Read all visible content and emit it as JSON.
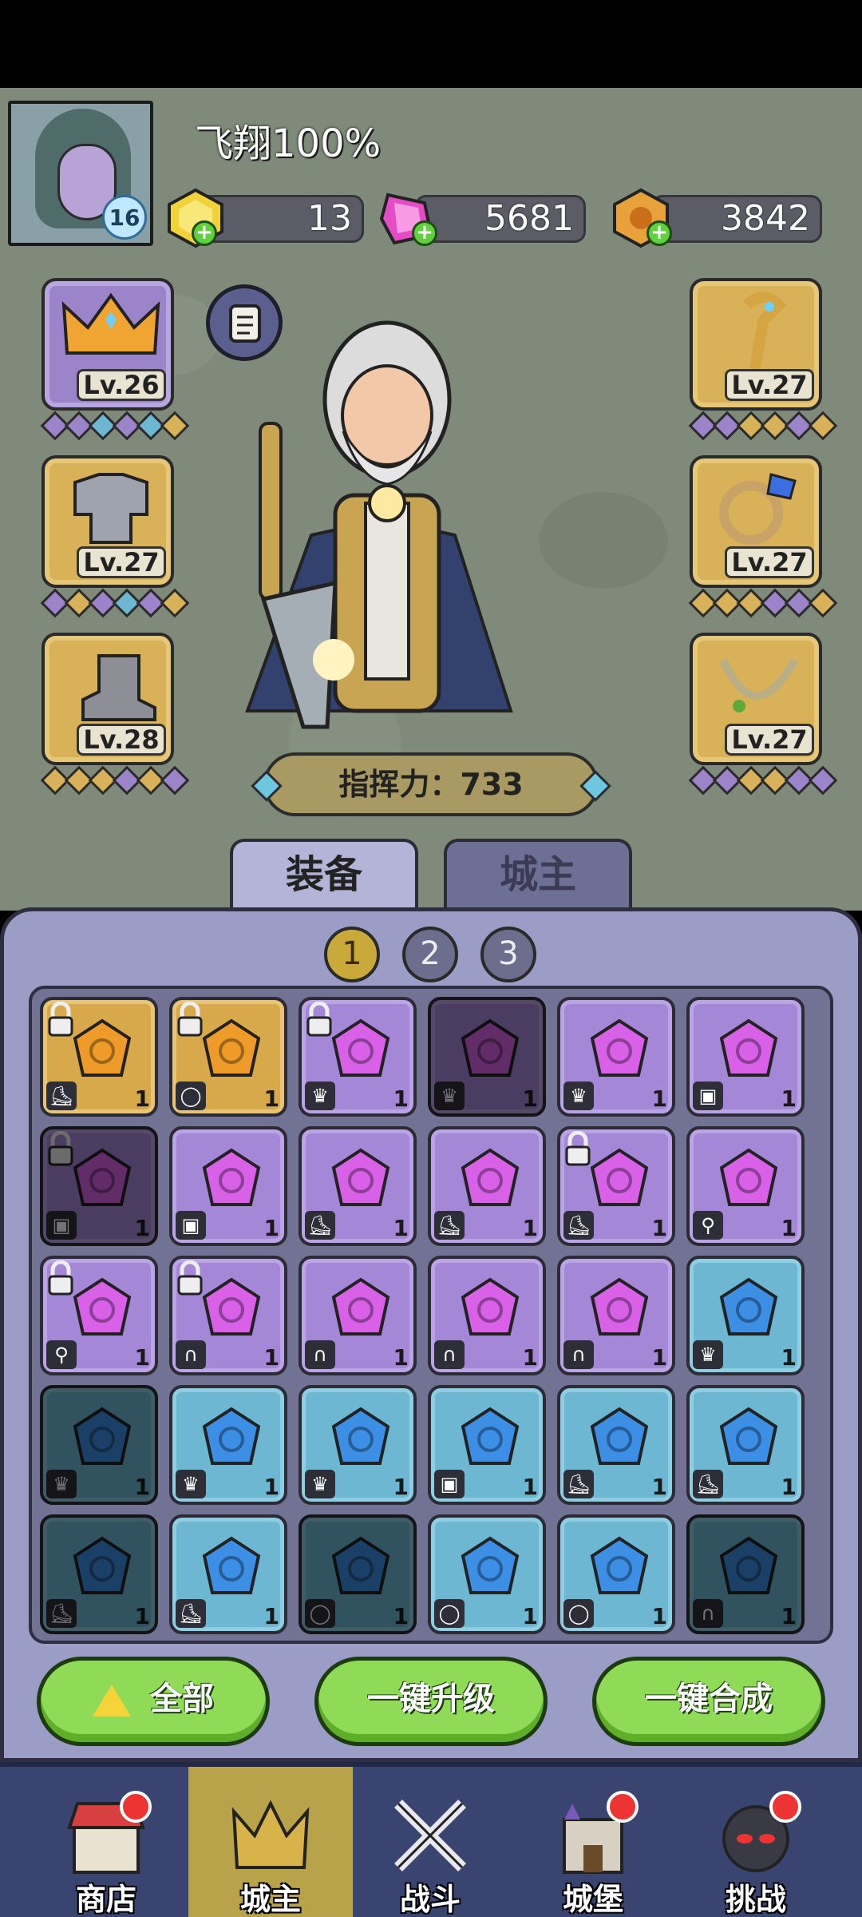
{
  "player": {
    "name": "飞翔100%",
    "level": "16"
  },
  "resources": [
    {
      "name": "gold-gem",
      "value": "13",
      "color": "#f2d23b"
    },
    {
      "name": "pink-crystal",
      "value": "5681",
      "color": "#e64bc6"
    },
    {
      "name": "coin",
      "value": "3842",
      "color": "#e9a23b"
    }
  ],
  "equipment": {
    "left": [
      {
        "slot": "crown",
        "level": "Lv.26",
        "rarity": "purple"
      },
      {
        "slot": "armor",
        "level": "Lv.27",
        "rarity": "gold"
      },
      {
        "slot": "boots",
        "level": "Lv.28",
        "rarity": "gold"
      }
    ],
    "right": [
      {
        "slot": "staff",
        "level": "Lv.27",
        "rarity": "gold"
      },
      {
        "slot": "ring",
        "level": "Lv.27",
        "rarity": "gold"
      },
      {
        "slot": "necklace",
        "level": "Lv.27",
        "rarity": "gold"
      }
    ]
  },
  "command_power": "指挥力：733",
  "tabs": {
    "equip": "装备",
    "lord": "城主"
  },
  "pages": [
    "1",
    "2",
    "3"
  ],
  "inventory": [
    {
      "c": "orange",
      "t": "boot",
      "lock": true,
      "dim": false,
      "n": "1"
    },
    {
      "c": "orange",
      "t": "ring",
      "lock": true,
      "dim": false,
      "n": "1"
    },
    {
      "c": "purple",
      "t": "crown",
      "lock": true,
      "dim": false,
      "n": "1"
    },
    {
      "c": "purple",
      "t": "crown",
      "lock": false,
      "dim": true,
      "n": "1"
    },
    {
      "c": "purple",
      "t": "crown",
      "lock": false,
      "dim": false,
      "n": "1"
    },
    {
      "c": "purple",
      "t": "armor",
      "lock": false,
      "dim": false,
      "n": "1"
    },
    {
      "c": "purple",
      "t": "armor",
      "lock": true,
      "dim": true,
      "n": "1"
    },
    {
      "c": "purple",
      "t": "armor",
      "lock": false,
      "dim": false,
      "n": "1"
    },
    {
      "c": "purple",
      "t": "boot",
      "lock": false,
      "dim": false,
      "n": "1"
    },
    {
      "c": "purple",
      "t": "boot",
      "lock": false,
      "dim": false,
      "n": "1"
    },
    {
      "c": "purple",
      "t": "boot",
      "lock": true,
      "dim": false,
      "n": "1"
    },
    {
      "c": "purple",
      "t": "staff",
      "lock": false,
      "dim": false,
      "n": "1"
    },
    {
      "c": "purple",
      "t": "staff",
      "lock": true,
      "dim": false,
      "n": "1"
    },
    {
      "c": "purple",
      "t": "neck",
      "lock": true,
      "dim": false,
      "n": "1"
    },
    {
      "c": "purple",
      "t": "neck",
      "lock": false,
      "dim": false,
      "n": "1"
    },
    {
      "c": "purple",
      "t": "neck",
      "lock": false,
      "dim": false,
      "n": "1"
    },
    {
      "c": "purple",
      "t": "neck",
      "lock": false,
      "dim": false,
      "n": "1"
    },
    {
      "c": "blue",
      "t": "crown",
      "lock": false,
      "dim": false,
      "n": "1"
    },
    {
      "c": "blue",
      "t": "crown",
      "lock": false,
      "dim": true,
      "n": "1"
    },
    {
      "c": "blue",
      "t": "crown",
      "lock": false,
      "dim": false,
      "n": "1"
    },
    {
      "c": "blue",
      "t": "crown",
      "lock": false,
      "dim": false,
      "n": "1"
    },
    {
      "c": "blue",
      "t": "armor",
      "lock": false,
      "dim": false,
      "n": "1"
    },
    {
      "c": "blue",
      "t": "boot",
      "lock": false,
      "dim": false,
      "n": "1"
    },
    {
      "c": "blue",
      "t": "boot",
      "lock": false,
      "dim": false,
      "n": "1"
    },
    {
      "c": "blue",
      "t": "boot",
      "lock": false,
      "dim": true,
      "n": "1"
    },
    {
      "c": "blue",
      "t": "boot",
      "lock": false,
      "dim": false,
      "n": "1"
    },
    {
      "c": "blue",
      "t": "ring",
      "lock": false,
      "dim": true,
      "n": "1"
    },
    {
      "c": "blue",
      "t": "ring",
      "lock": false,
      "dim": false,
      "n": "1"
    },
    {
      "c": "blue",
      "t": "ring",
      "lock": false,
      "dim": false,
      "n": "1"
    },
    {
      "c": "blue",
      "t": "neck",
      "lock": false,
      "dim": true,
      "n": "1"
    }
  ],
  "actions": {
    "all": "全部",
    "upgrade": "一键升级",
    "merge": "一键合成"
  },
  "nav": [
    {
      "label": "商店",
      "badge": true,
      "active": false
    },
    {
      "label": "城主",
      "badge": false,
      "active": true
    },
    {
      "label": "战斗",
      "badge": false,
      "active": false
    },
    {
      "label": "城堡",
      "badge": true,
      "active": false
    },
    {
      "label": "挑战",
      "badge": true,
      "active": false
    }
  ]
}
